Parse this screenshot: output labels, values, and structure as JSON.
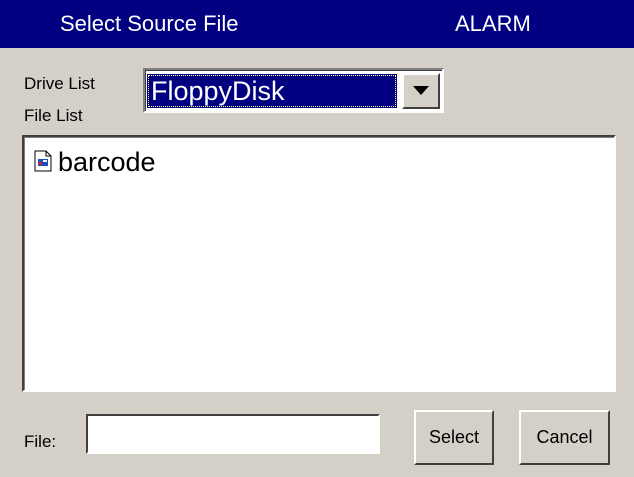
{
  "window": {
    "title": "Select Source File",
    "mode": "ALARM"
  },
  "labels": {
    "drive_list": "Drive List",
    "file_list": "File List",
    "file": "File:"
  },
  "drive": {
    "selected": "FloppyDisk"
  },
  "files": [
    {
      "name": "barcode",
      "icon": "file-icon"
    }
  ],
  "file_input": {
    "value": ""
  },
  "buttons": {
    "select": "Select",
    "cancel": "Cancel"
  },
  "colors": {
    "titlebar": "#000080",
    "selection": "#000080",
    "background": "#d4d0c8"
  }
}
